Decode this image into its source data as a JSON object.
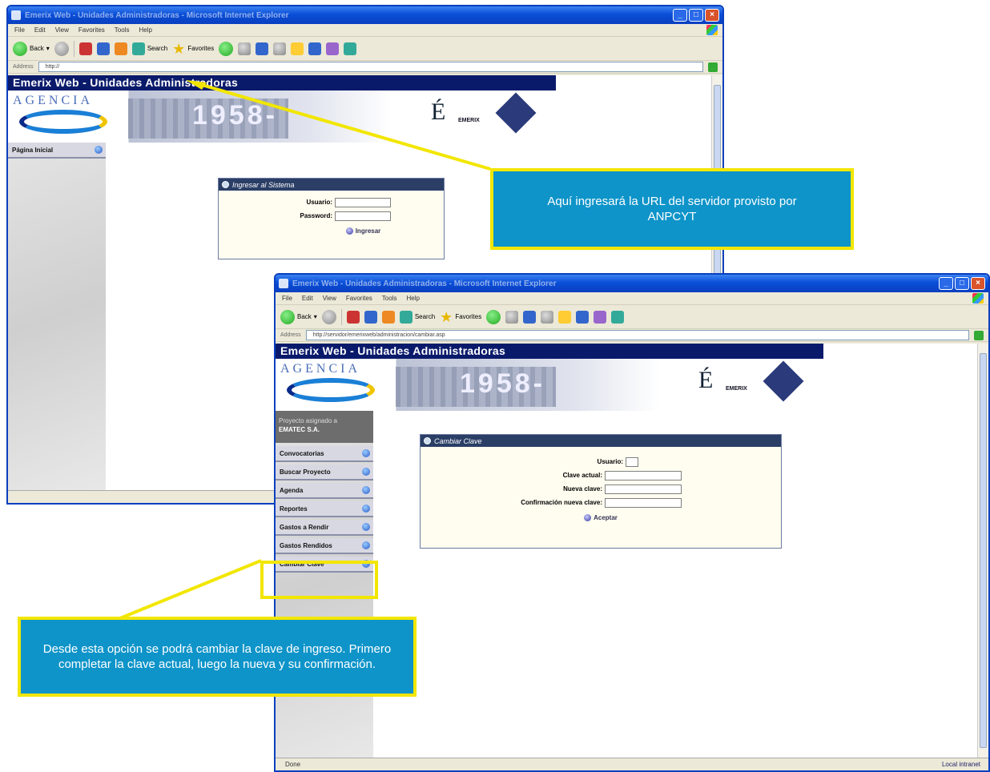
{
  "window1": {
    "title": "Emerix Web - Unidades Administradoras - Microsoft Internet Explorer",
    "menu": [
      "File",
      "Edit",
      "View",
      "Favorites",
      "Tools",
      "Help"
    ],
    "toolbar": {
      "back": "Back",
      "search": "Search",
      "favorites": "Favorites"
    },
    "address_label": "Address",
    "address_value": "http://",
    "site_title": "Emerix Web - Unidades Administradoras",
    "banner": {
      "agencia": "AGENCIA",
      "emerix": "EMERIX"
    },
    "sidebar": [
      {
        "label": "Página Inicial"
      }
    ],
    "login_panel": {
      "title": "Ingresar al Sistema",
      "user_label": "Usuario:",
      "password_label": "Password:",
      "submit": "Ingresar"
    }
  },
  "window2": {
    "title": "Emerix Web - Unidades Administradoras - Microsoft Internet Explorer",
    "menu": [
      "File",
      "Edit",
      "View",
      "Favorites",
      "Tools",
      "Help"
    ],
    "toolbar": {
      "back": "Back",
      "search": "Search",
      "favorites": "Favorites"
    },
    "address_label": "Address",
    "address_value": "http://servidor/emerixweb/administracion/cambiar.asp",
    "site_title": "Emerix Web - Unidades Administradoras",
    "banner": {
      "agencia": "AGENCIA",
      "emerix": "EMERIX"
    },
    "user_box": {
      "line1": "Proyecto asignado a",
      "line2": "EMATEC S.A."
    },
    "sidebar": [
      {
        "label": "Convocatorias"
      },
      {
        "label": "Buscar Proyecto"
      },
      {
        "label": "Agenda"
      },
      {
        "label": "Reportes"
      },
      {
        "label": "Gastos a Rendir"
      },
      {
        "label": "Gastos Rendidos"
      },
      {
        "label": "Cambiar Clave"
      }
    ],
    "change_panel": {
      "title": "Cambiar Clave",
      "user_label": "Usuario:",
      "current_label": "Clave actual:",
      "new_label": "Nueva clave:",
      "confirm_label": "Confirmación nueva clave:",
      "submit": "Aceptar"
    },
    "status_left": "Done",
    "status_right": "Local intranet"
  },
  "callouts": {
    "url": "Aquí ingresará la URL del servidor provisto por ANPCYT",
    "password": "Desde esta opción se podrá cambiar la clave de ingreso. Primero completar la clave actual, luego la nueva y su confirmación."
  },
  "colors": {
    "callout_bg": "#0e94c9",
    "callout_border": "#f2e600",
    "header_bg": "#0a1a6b",
    "panel_head": "#2a3e66"
  }
}
